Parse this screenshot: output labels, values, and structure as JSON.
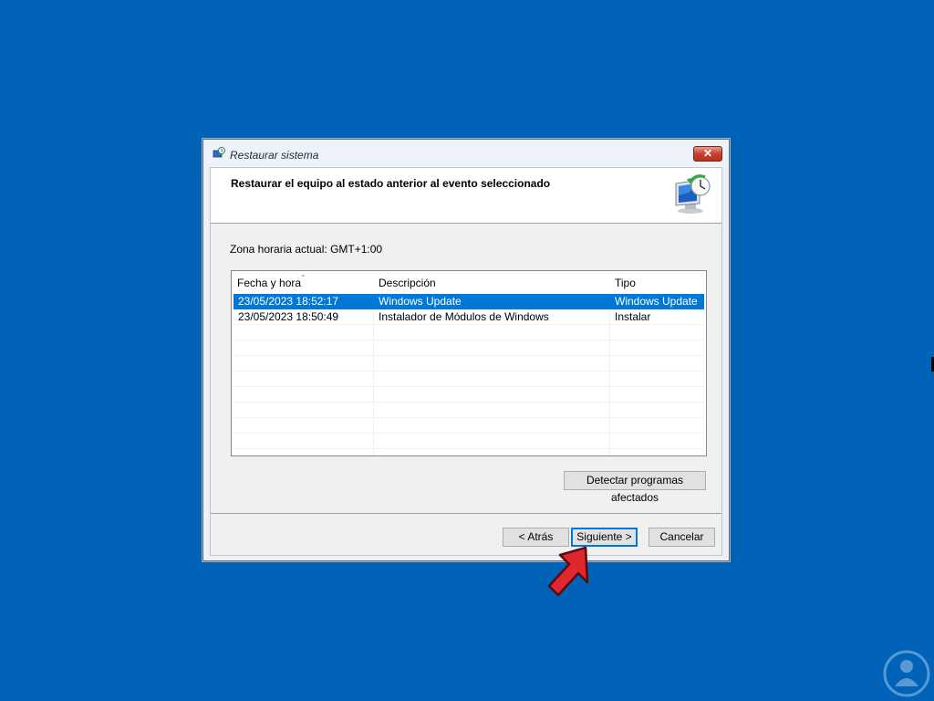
{
  "window": {
    "title": "Restaurar sistema",
    "close_label": "✕"
  },
  "header": {
    "title": "Restaurar el equipo al estado anterior al evento seleccionado",
    "icon": "system-restore-icon"
  },
  "timezone_text": "Zona horaria actual: GMT+1:00",
  "restore_points": {
    "columns": [
      "Fecha y hora",
      "Descripción",
      "Tipo"
    ],
    "sort_indicator": "⌄",
    "rows": [
      {
        "date": "23/05/2023 18:52:17",
        "description": "Windows Update",
        "type": "Windows Update",
        "selected": true
      },
      {
        "date": "23/05/2023 18:50:49",
        "description": "Instalador de Módulos de Windows",
        "type": "Instalar",
        "selected": false
      }
    ]
  },
  "buttons": {
    "detect": "Detectar programas afectados",
    "back": "< Atrás",
    "next": "Siguiente >",
    "cancel": "Cancelar"
  },
  "colors": {
    "desktop": "#0063b8",
    "selection": "#0078d7",
    "arrow": "#e0262f"
  }
}
